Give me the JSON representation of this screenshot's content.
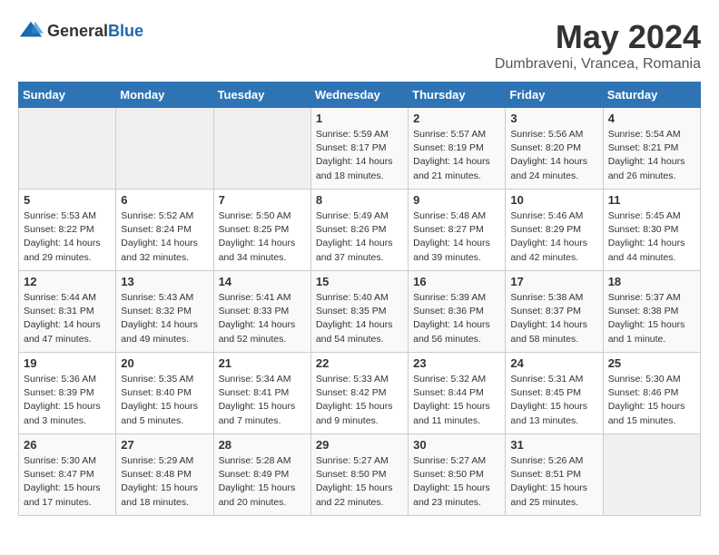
{
  "header": {
    "logo_general": "General",
    "logo_blue": "Blue",
    "month": "May 2024",
    "location": "Dumbraveni, Vrancea, Romania"
  },
  "weekdays": [
    "Sunday",
    "Monday",
    "Tuesday",
    "Wednesday",
    "Thursday",
    "Friday",
    "Saturday"
  ],
  "weeks": [
    [
      {
        "day": "",
        "empty": true
      },
      {
        "day": "",
        "empty": true
      },
      {
        "day": "",
        "empty": true
      },
      {
        "day": "1",
        "sunrise": "5:59 AM",
        "sunset": "8:17 PM",
        "daylight": "14 hours and 18 minutes."
      },
      {
        "day": "2",
        "sunrise": "5:57 AM",
        "sunset": "8:19 PM",
        "daylight": "14 hours and 21 minutes."
      },
      {
        "day": "3",
        "sunrise": "5:56 AM",
        "sunset": "8:20 PM",
        "daylight": "14 hours and 24 minutes."
      },
      {
        "day": "4",
        "sunrise": "5:54 AM",
        "sunset": "8:21 PM",
        "daylight": "14 hours and 26 minutes."
      }
    ],
    [
      {
        "day": "5",
        "sunrise": "5:53 AM",
        "sunset": "8:22 PM",
        "daylight": "14 hours and 29 minutes."
      },
      {
        "day": "6",
        "sunrise": "5:52 AM",
        "sunset": "8:24 PM",
        "daylight": "14 hours and 32 minutes."
      },
      {
        "day": "7",
        "sunrise": "5:50 AM",
        "sunset": "8:25 PM",
        "daylight": "14 hours and 34 minutes."
      },
      {
        "day": "8",
        "sunrise": "5:49 AM",
        "sunset": "8:26 PM",
        "daylight": "14 hours and 37 minutes."
      },
      {
        "day": "9",
        "sunrise": "5:48 AM",
        "sunset": "8:27 PM",
        "daylight": "14 hours and 39 minutes."
      },
      {
        "day": "10",
        "sunrise": "5:46 AM",
        "sunset": "8:29 PM",
        "daylight": "14 hours and 42 minutes."
      },
      {
        "day": "11",
        "sunrise": "5:45 AM",
        "sunset": "8:30 PM",
        "daylight": "14 hours and 44 minutes."
      }
    ],
    [
      {
        "day": "12",
        "sunrise": "5:44 AM",
        "sunset": "8:31 PM",
        "daylight": "14 hours and 47 minutes."
      },
      {
        "day": "13",
        "sunrise": "5:43 AM",
        "sunset": "8:32 PM",
        "daylight": "14 hours and 49 minutes."
      },
      {
        "day": "14",
        "sunrise": "5:41 AM",
        "sunset": "8:33 PM",
        "daylight": "14 hours and 52 minutes."
      },
      {
        "day": "15",
        "sunrise": "5:40 AM",
        "sunset": "8:35 PM",
        "daylight": "14 hours and 54 minutes."
      },
      {
        "day": "16",
        "sunrise": "5:39 AM",
        "sunset": "8:36 PM",
        "daylight": "14 hours and 56 minutes."
      },
      {
        "day": "17",
        "sunrise": "5:38 AM",
        "sunset": "8:37 PM",
        "daylight": "14 hours and 58 minutes."
      },
      {
        "day": "18",
        "sunrise": "5:37 AM",
        "sunset": "8:38 PM",
        "daylight": "15 hours and 1 minute."
      }
    ],
    [
      {
        "day": "19",
        "sunrise": "5:36 AM",
        "sunset": "8:39 PM",
        "daylight": "15 hours and 3 minutes."
      },
      {
        "day": "20",
        "sunrise": "5:35 AM",
        "sunset": "8:40 PM",
        "daylight": "15 hours and 5 minutes."
      },
      {
        "day": "21",
        "sunrise": "5:34 AM",
        "sunset": "8:41 PM",
        "daylight": "15 hours and 7 minutes."
      },
      {
        "day": "22",
        "sunrise": "5:33 AM",
        "sunset": "8:42 PM",
        "daylight": "15 hours and 9 minutes."
      },
      {
        "day": "23",
        "sunrise": "5:32 AM",
        "sunset": "8:44 PM",
        "daylight": "15 hours and 11 minutes."
      },
      {
        "day": "24",
        "sunrise": "5:31 AM",
        "sunset": "8:45 PM",
        "daylight": "15 hours and 13 minutes."
      },
      {
        "day": "25",
        "sunrise": "5:30 AM",
        "sunset": "8:46 PM",
        "daylight": "15 hours and 15 minutes."
      }
    ],
    [
      {
        "day": "26",
        "sunrise": "5:30 AM",
        "sunset": "8:47 PM",
        "daylight": "15 hours and 17 minutes."
      },
      {
        "day": "27",
        "sunrise": "5:29 AM",
        "sunset": "8:48 PM",
        "daylight": "15 hours and 18 minutes."
      },
      {
        "day": "28",
        "sunrise": "5:28 AM",
        "sunset": "8:49 PM",
        "daylight": "15 hours and 20 minutes."
      },
      {
        "day": "29",
        "sunrise": "5:27 AM",
        "sunset": "8:50 PM",
        "daylight": "15 hours and 22 minutes."
      },
      {
        "day": "30",
        "sunrise": "5:27 AM",
        "sunset": "8:50 PM",
        "daylight": "15 hours and 23 minutes."
      },
      {
        "day": "31",
        "sunrise": "5:26 AM",
        "sunset": "8:51 PM",
        "daylight": "15 hours and 25 minutes."
      },
      {
        "day": "",
        "empty": true
      }
    ]
  ],
  "labels": {
    "sunrise": "Sunrise:",
    "sunset": "Sunset:",
    "daylight": "Daylight:"
  }
}
